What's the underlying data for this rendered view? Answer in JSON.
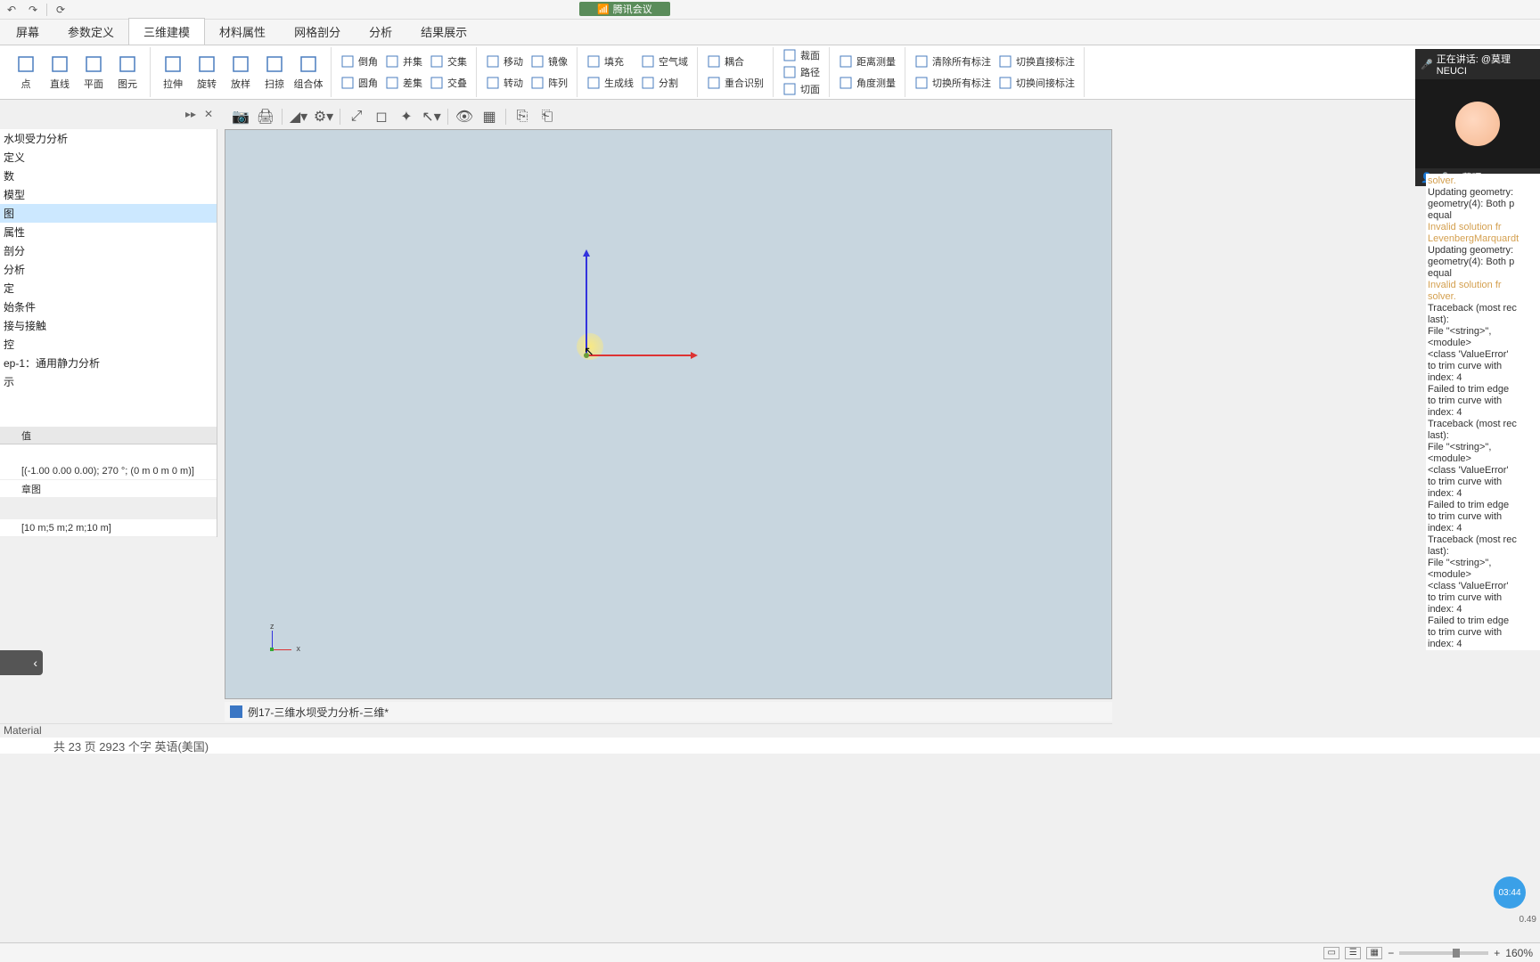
{
  "screenshare": "腾讯会议",
  "qat": {
    "undo": "↶",
    "redo": "↷",
    "refresh": "⟳"
  },
  "tabs": [
    "屏幕",
    "参数定义",
    "三维建模",
    "材料属性",
    "网格剖分",
    "分析",
    "结果展示"
  ],
  "activeTab": 2,
  "ribbon": {
    "group1": [
      {
        "label": "点"
      },
      {
        "label": "直线"
      },
      {
        "label": "平面"
      },
      {
        "label": "图元"
      }
    ],
    "group2": [
      {
        "label": "拉伸"
      },
      {
        "label": "旋转"
      },
      {
        "label": "放样"
      },
      {
        "label": "扫掠"
      },
      {
        "label": "组合体"
      }
    ],
    "col1": [
      {
        "label": "倒角"
      },
      {
        "label": "圆角"
      }
    ],
    "col2": [
      {
        "label": "并集"
      },
      {
        "label": "差集"
      }
    ],
    "col3": [
      {
        "label": "交集"
      },
      {
        "label": "交叠"
      }
    ],
    "col4": [
      {
        "label": "移动"
      },
      {
        "label": "转动"
      }
    ],
    "col5": [
      {
        "label": "镜像"
      },
      {
        "label": "阵列"
      }
    ],
    "col6": [
      {
        "label": "填充"
      },
      {
        "label": "生成线"
      }
    ],
    "col7": [
      {
        "label": "空气域"
      },
      {
        "label": "分割"
      }
    ],
    "col8": [
      {
        "label": "耦合"
      },
      {
        "label": "重合识别"
      }
    ],
    "col9": [
      {
        "label": "裁面"
      },
      {
        "label": "路径"
      },
      {
        "label": "切面"
      }
    ],
    "col10": [
      {
        "label": "距离测量"
      },
      {
        "label": "角度测量"
      }
    ],
    "col11": [
      {
        "label": "清除所有标注"
      },
      {
        "label": "切换所有标注"
      }
    ],
    "col12": [
      {
        "label": "切换直接标注"
      },
      {
        "label": "切换间接标注"
      }
    ]
  },
  "tree": [
    "水坝受力分析",
    "定义",
    "数",
    "模型",
    "图",
    "属性",
    "剖分",
    "分析",
    "定",
    "始条件",
    "接与接触",
    "控",
    "ep-1：通用静力分析",
    "示"
  ],
  "treeSelected": 4,
  "props": {
    "header": "值",
    "row1": "[(-1.00 0.00 0.00); 270 °; (0 m  0 m  0 m)]",
    "row2": "章图",
    "row3": "[10 m;5 m;2 m;10 m]"
  },
  "docTab": "例17-三维水坝受力分析-三维*",
  "materialBar": "Material",
  "cutoffText": "共 23 页    2923 个字        英语(美国)",
  "zoomPercent": "160%",
  "meeting": {
    "speaking": "正在讲话: @莫理NEUCI",
    "name": "@莫理NEUCIVIL"
  },
  "console": [
    {
      "t": "solver.",
      "c": "warn"
    },
    {
      "t": "Updating geometry:"
    },
    {
      "t": "geometry(4): Both p"
    },
    {
      "t": "equal"
    },
    {
      "t": "Invalid solution fr",
      "c": "warn"
    },
    {
      "t": "LevenbergMarquardt",
      "c": "warn"
    },
    {
      "t": "Updating geometry:"
    },
    {
      "t": "geometry(4): Both p"
    },
    {
      "t": "equal"
    },
    {
      "t": "Invalid solution fr",
      "c": "warn"
    },
    {
      "t": "solver.",
      "c": "warn"
    },
    {
      "t": "Traceback (most rec"
    },
    {
      "t": "last):"
    },
    {
      "t": "  File \"<string>\","
    },
    {
      "t": "<module>"
    },
    {
      "t": "<class 'ValueError'"
    },
    {
      "t": "to trim curve with"
    },
    {
      "t": "index: 4"
    },
    {
      "t": "Failed to trim edge"
    },
    {
      "t": "to trim curve with"
    },
    {
      "t": "index: 4"
    },
    {
      "t": "Traceback (most rec"
    },
    {
      "t": "last):"
    },
    {
      "t": "  File \"<string>\","
    },
    {
      "t": "<module>"
    },
    {
      "t": "<class 'ValueError'"
    },
    {
      "t": "to trim curve with"
    },
    {
      "t": "index: 4"
    },
    {
      "t": "Failed to trim edge"
    },
    {
      "t": "to trim curve with"
    },
    {
      "t": "index: 4"
    },
    {
      "t": "Traceback (most rec"
    },
    {
      "t": "last):"
    },
    {
      "t": "  File \"<string>\","
    },
    {
      "t": "<module>"
    },
    {
      "t": "<class 'ValueError'"
    },
    {
      "t": "to trim curve with"
    },
    {
      "t": "index: 4"
    },
    {
      "t": "Failed to trim edge"
    },
    {
      "t": "to trim curve with"
    },
    {
      "t": "index: 4"
    }
  ],
  "timer": "03:44",
  "pct": "0.49"
}
